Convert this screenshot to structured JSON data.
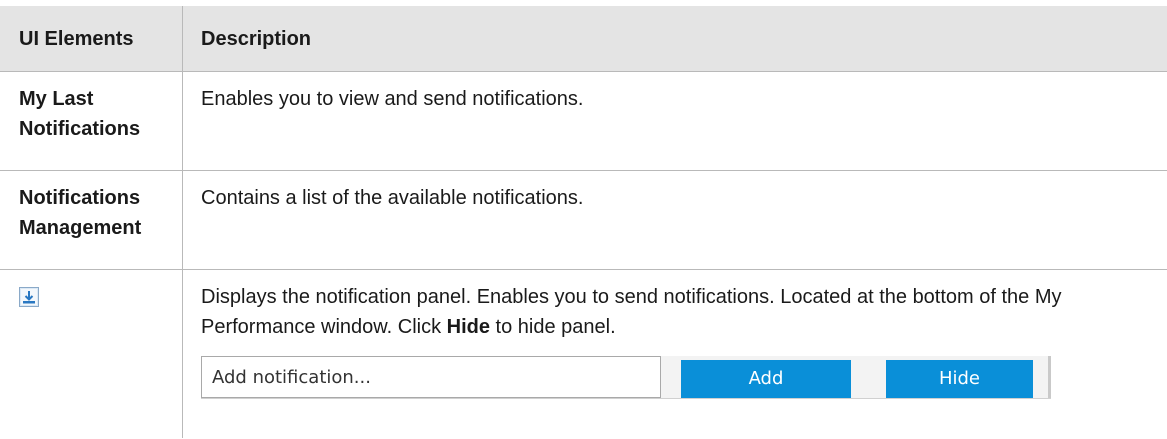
{
  "table": {
    "headers": [
      "UI Elements",
      "Description"
    ],
    "rows": [
      {
        "element": "My Last Notifications",
        "description": "Enables you to view and send notifications."
      },
      {
        "element": "Notifications Management",
        "description": "Contains a list of the available notifications."
      },
      {
        "element_icon": "show-notification-panel-icon",
        "description_before": "Displays the notification panel. Enables you to send notifications. Located at the bottom of the My Performance window. Click ",
        "description_bold": "Hide",
        "description_after": " to hide panel."
      }
    ]
  },
  "notification_panel": {
    "input_placeholder": "Add notification...",
    "add_label": "Add",
    "hide_label": "Hide"
  },
  "colors": {
    "header_bg": "#e4e4e4",
    "button_bg": "#0a8fd8",
    "border": "#b9b9b9"
  }
}
